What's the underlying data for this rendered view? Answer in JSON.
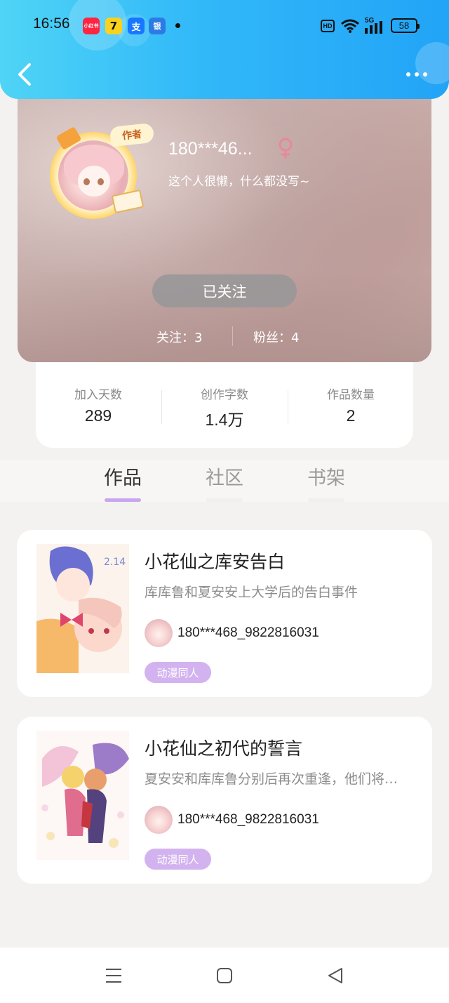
{
  "status_bar": {
    "time": "16:56",
    "app_icons": [
      "小红书",
      "7",
      "支",
      "银"
    ],
    "network": "5G",
    "battery": "58"
  },
  "colors": {
    "header_gradient_start": "#4fd4f6",
    "header_gradient_end": "#22a4f7",
    "accent_purple": "#c9a7ee",
    "tag_purple": "#d3b3ef",
    "gender_pink": "#e8889a"
  },
  "header": {
    "back_icon": "chevron-left-icon",
    "more_icon": "more-horizontal-icon"
  },
  "profile": {
    "author_badge": "作者",
    "username": "180***46...",
    "gender_icon": "female-icon",
    "bio": "这个人很懒，什么都没写~",
    "follow_button": "已关注",
    "following_label": "关注：3",
    "followers_label": "粉丝：4"
  },
  "stats": [
    {
      "label": "加入天数",
      "value": "289"
    },
    {
      "label": "创作字数",
      "value": "1.4万"
    },
    {
      "label": "作品数量",
      "value": "2"
    }
  ],
  "tabs": [
    {
      "label": "作品",
      "active": true
    },
    {
      "label": "社区",
      "active": false
    },
    {
      "label": "书架",
      "active": false
    }
  ],
  "books": [
    {
      "title": "小花仙之库安告白",
      "description": "库库鲁和夏安安上大学后的告白事件",
      "author": "180***468_9822816031",
      "tag": "动漫同人"
    },
    {
      "title": "小花仙之初代的誓言",
      "description": "夏安安和库库鲁分别后再次重逢，他们将…",
      "author": "180***468_9822816031",
      "tag": "动漫同人"
    }
  ],
  "nav": {
    "menu_icon": "menu-icon",
    "home_icon": "square-home-icon",
    "back_icon": "triangle-back-icon"
  }
}
